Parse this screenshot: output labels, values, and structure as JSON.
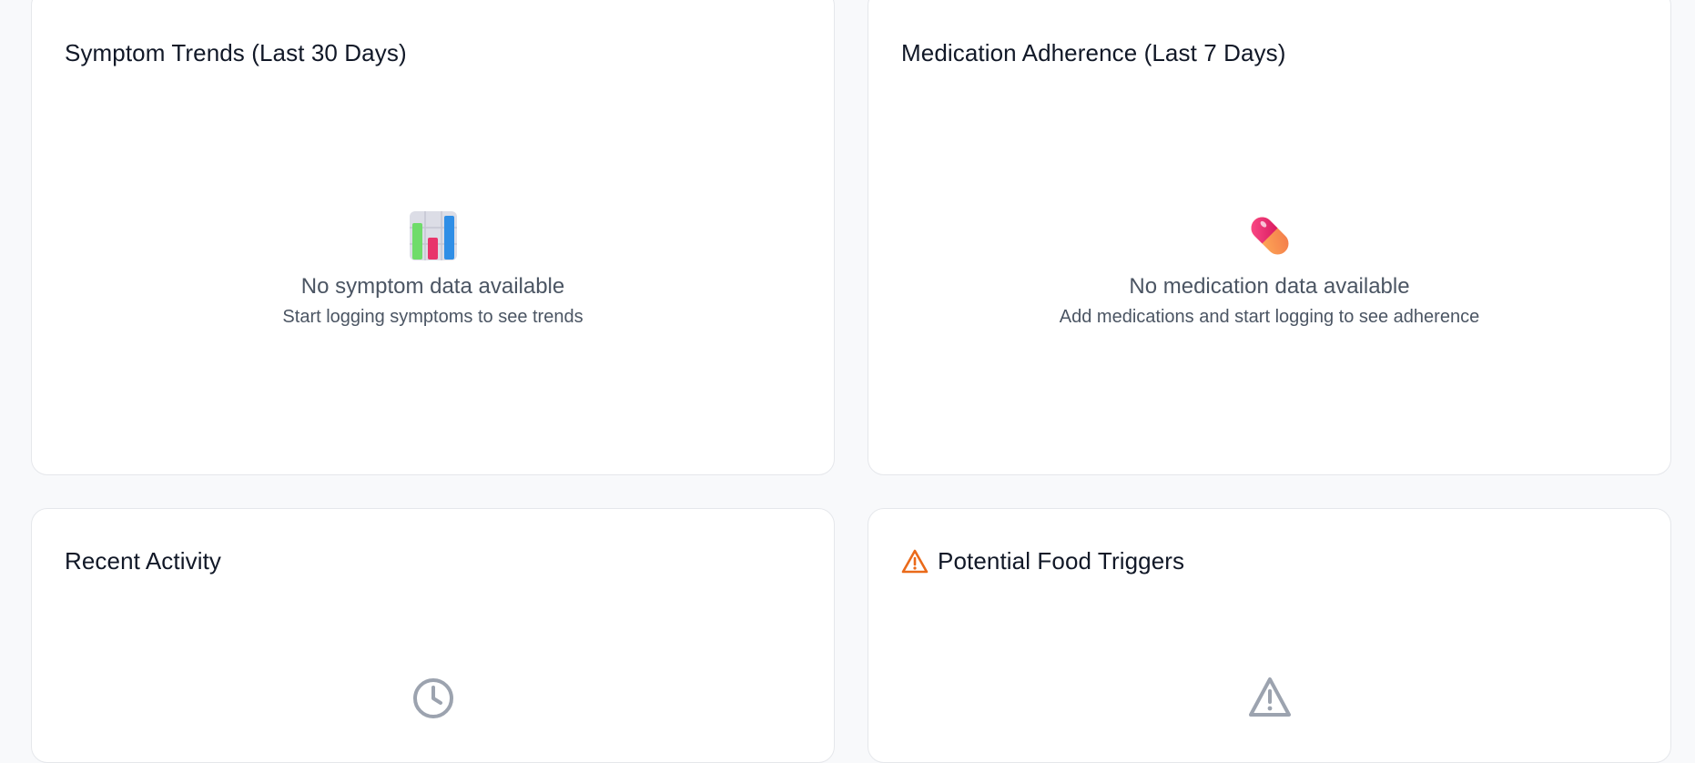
{
  "cards": {
    "symptom_trends": {
      "title": "Symptom Trends (Last 30 Days)",
      "empty_title": "No symptom data available",
      "empty_subtitle": "Start logging symptoms to see trends",
      "icon": "bar-chart-icon"
    },
    "medication_adherence": {
      "title": "Medication Adherence (Last 7 Days)",
      "empty_title": "No medication data available",
      "empty_subtitle": "Add medications and start logging to see adherence",
      "icon": "pill-icon"
    },
    "recent_activity": {
      "title": "Recent Activity",
      "icon": "clock-icon"
    },
    "food_triggers": {
      "title": "Potential Food Triggers",
      "title_icon": "warning-icon",
      "icon": "warning-icon"
    }
  },
  "colors": {
    "background": "#f8f9fb",
    "card": "#ffffff",
    "border": "#e5e7eb",
    "title": "#111827",
    "muted": "#4b5563",
    "warning": "#ea6a1a",
    "icon_gray": "#9ca3af"
  }
}
